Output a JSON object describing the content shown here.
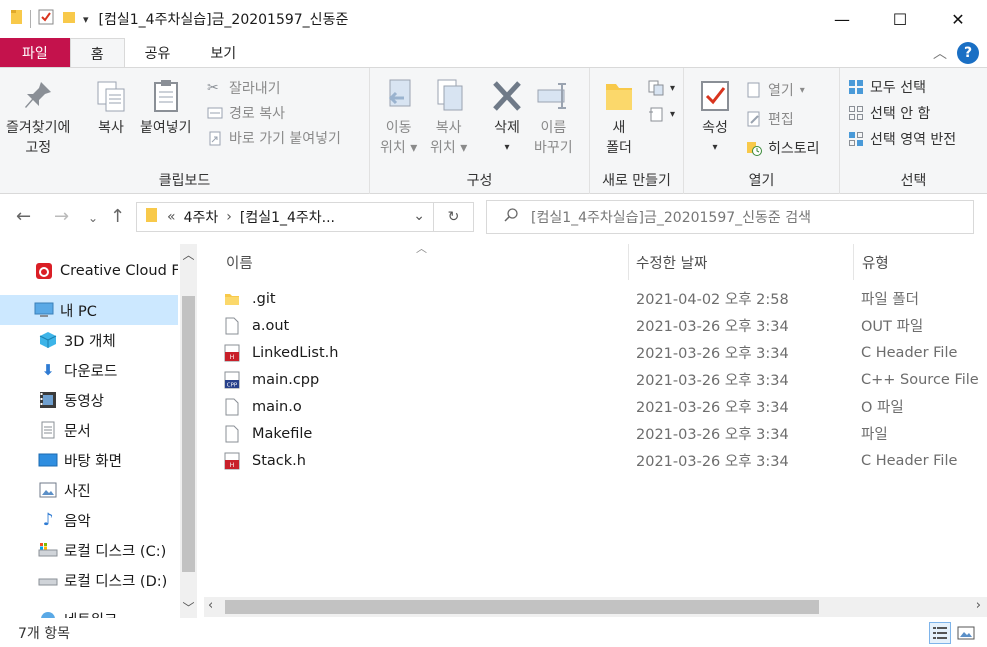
{
  "window": {
    "title": "[컴실1_4주차실습]금_20201597_신동준",
    "minimize_glyph": "—",
    "maximize_glyph": "☐",
    "close_glyph": "✕"
  },
  "ribbon_tabs": [
    {
      "label": "파일"
    },
    {
      "label": "홈"
    },
    {
      "label": "공유"
    },
    {
      "label": "보기"
    }
  ],
  "ribbon": {
    "clipboard": {
      "group_label": "클립보드",
      "pin_label_1": "즐겨찾기에",
      "pin_label_2": "고정",
      "copy_label": "복사",
      "paste_label": "붙여넣기",
      "cut_label": "잘라내기",
      "copy_path_label": "경로 복사",
      "paste_shortcut_label": "바로 가기 붙여넣기"
    },
    "organize": {
      "group_label": "구성",
      "move_label_1": "이동",
      "move_label_2": "위치",
      "copyto_label_1": "복사",
      "copyto_label_2": "위치",
      "delete_label": "삭제",
      "rename_label_1": "이름",
      "rename_label_2": "바꾸기"
    },
    "new": {
      "group_label": "새로 만들기",
      "new_folder_label_1": "새",
      "new_folder_label_2": "폴더"
    },
    "open": {
      "group_label": "열기",
      "properties_label": "속성",
      "open_label": "열기",
      "edit_label": "편집",
      "history_label": "히스토리"
    },
    "select": {
      "group_label": "선택",
      "select_all_label": "모두 선택",
      "select_none_label": "선택 안 함",
      "invert_label": "선택 영역 반전"
    }
  },
  "address": {
    "prefix": "«",
    "crumb_1": "4주차",
    "separator": "›",
    "crumb_2": "[컴실1_4주차...",
    "search_placeholder": "[컴실1_4주차실습]금_20201597_신동준 검색"
  },
  "nav_pane": {
    "items": [
      {
        "label": "Creative Cloud Fil",
        "icon": "creative-cloud-icon"
      },
      {
        "label": "내 PC",
        "icon": "pc-icon"
      },
      {
        "label": "3D 개체",
        "icon": "3d-objects-icon"
      },
      {
        "label": "다운로드",
        "icon": "download-icon"
      },
      {
        "label": "동영상",
        "icon": "video-icon"
      },
      {
        "label": "문서",
        "icon": "document-icon"
      },
      {
        "label": "바탕 화면",
        "icon": "desktop-icon"
      },
      {
        "label": "사진",
        "icon": "pictures-icon"
      },
      {
        "label": "음악",
        "icon": "music-icon"
      },
      {
        "label": "로컬 디스크 (C:)",
        "icon": "drive-c-icon"
      },
      {
        "label": "로컬 디스크 (D:)",
        "icon": "drive-d-icon"
      },
      {
        "label": "네트워크",
        "icon": "network-icon"
      }
    ]
  },
  "file_list": {
    "columns": {
      "name": "이름",
      "date": "수정한 날짜",
      "type": "유형"
    },
    "rows": [
      {
        "name": ".git",
        "date": "2021-04-02 오후 2:58",
        "type": "파일 폴더",
        "icon": "folder-icon"
      },
      {
        "name": "a.out",
        "date": "2021-03-26 오후 3:34",
        "type": "OUT 파일",
        "icon": "file-icon"
      },
      {
        "name": "LinkedList.h",
        "date": "2021-03-26 오후 3:34",
        "type": "C Header File",
        "icon": "header-file-icon"
      },
      {
        "name": "main.cpp",
        "date": "2021-03-26 오후 3:34",
        "type": "C++ Source File",
        "icon": "cpp-file-icon"
      },
      {
        "name": "main.o",
        "date": "2021-03-26 오후 3:34",
        "type": "O 파일",
        "icon": "file-icon"
      },
      {
        "name": "Makefile",
        "date": "2021-03-26 오후 3:34",
        "type": "파일",
        "icon": "file-icon"
      },
      {
        "name": "Stack.h",
        "date": "2021-03-26 오후 3:34",
        "type": "C Header File",
        "icon": "header-file-icon"
      }
    ]
  },
  "status": {
    "item_count": "7개 항목"
  },
  "colors": {
    "file_tab": "#c4124c",
    "selection": "#cce8ff",
    "accent": "#1a6fc4"
  }
}
